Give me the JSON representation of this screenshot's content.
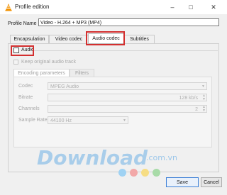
{
  "window": {
    "title": "Profile edition",
    "minimize_glyph": "–",
    "maximize_glyph": "□",
    "close_glyph": "✕"
  },
  "profile": {
    "name_label": "Profile Name",
    "name_value": "Video - H.264 + MP3 (MP4)"
  },
  "tabs": [
    {
      "label": "Encapsulation"
    },
    {
      "label": "Video codec"
    },
    {
      "label": "Audio codec",
      "active": true
    },
    {
      "label": "Subtitles"
    }
  ],
  "audio": {
    "enable_label": "Audio",
    "enabled": false,
    "keep_original_label": "Keep original audio track",
    "subtabs": [
      {
        "label": "Encoding parameters"
      },
      {
        "label": "Filters"
      }
    ],
    "fields": {
      "codec_label": "Codec",
      "codec_value": "MPEG Audio",
      "bitrate_label": "Bitrate",
      "bitrate_value": "128 kb/s",
      "channels_label": "Channels",
      "channels_value": "2",
      "samplerate_label": "Sample Rate",
      "samplerate_value": "44100 Hz"
    }
  },
  "watermark": {
    "text": "Download",
    "suffix": ".com.vn"
  },
  "buttons": {
    "save": "Save",
    "cancel": "Cancel"
  },
  "colors": {
    "highlight": "#d32f2f",
    "watermark": "#9cc7ea"
  }
}
